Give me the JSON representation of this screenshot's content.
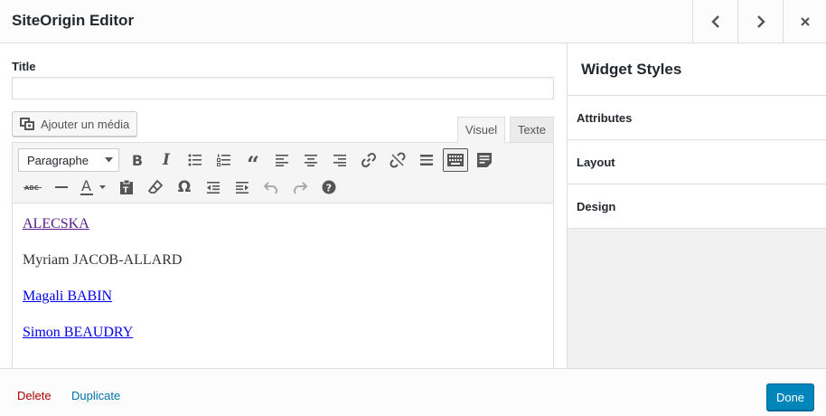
{
  "header": {
    "title": "SiteOrigin Editor",
    "prev_icon": "chevron-left-icon",
    "next_icon": "chevron-right-icon",
    "close_icon": "close-icon"
  },
  "main": {
    "title_label": "Title",
    "title_value": "",
    "add_media_label": "Ajouter un média",
    "tabs": [
      {
        "label": "Visuel",
        "active": true
      },
      {
        "label": "Texte",
        "active": false
      }
    ],
    "format_select": "Paragraphe",
    "toolbar_row1": [
      "bold-icon",
      "italic-icon",
      "bullet-list-icon",
      "numbered-list-icon",
      "blockquote-icon",
      "align-left-icon",
      "align-center-icon",
      "align-right-icon",
      "link-icon",
      "unlink-icon",
      "read-more-icon",
      "toolbar-toggle-icon",
      "form-icon"
    ],
    "toolbar_row2": [
      "strikethrough-icon",
      "horizontal-line-icon",
      "text-color-icon",
      "paste-text-icon",
      "clear-formatting-icon",
      "special-character-icon",
      "outdent-icon",
      "indent-icon",
      "undo-icon",
      "redo-icon",
      "help-icon"
    ],
    "content": [
      {
        "text": "ALECSKA",
        "link": true,
        "visited": true
      },
      {
        "text": "Myriam JACOB-ALLARD",
        "link": false
      },
      {
        "text": "Magali BABIN",
        "link": true
      },
      {
        "text": "Simon BEAUDRY",
        "link": true
      }
    ]
  },
  "sidebar": {
    "title": "Widget Styles",
    "sections": [
      "Attributes",
      "Layout",
      "Design"
    ]
  },
  "footer": {
    "delete_label": "Delete",
    "duplicate_label": "Duplicate",
    "done_label": "Done"
  },
  "colors": {
    "primary_button": "#0085ba",
    "delete_link": "#aa0000",
    "action_link": "#0073aa"
  }
}
